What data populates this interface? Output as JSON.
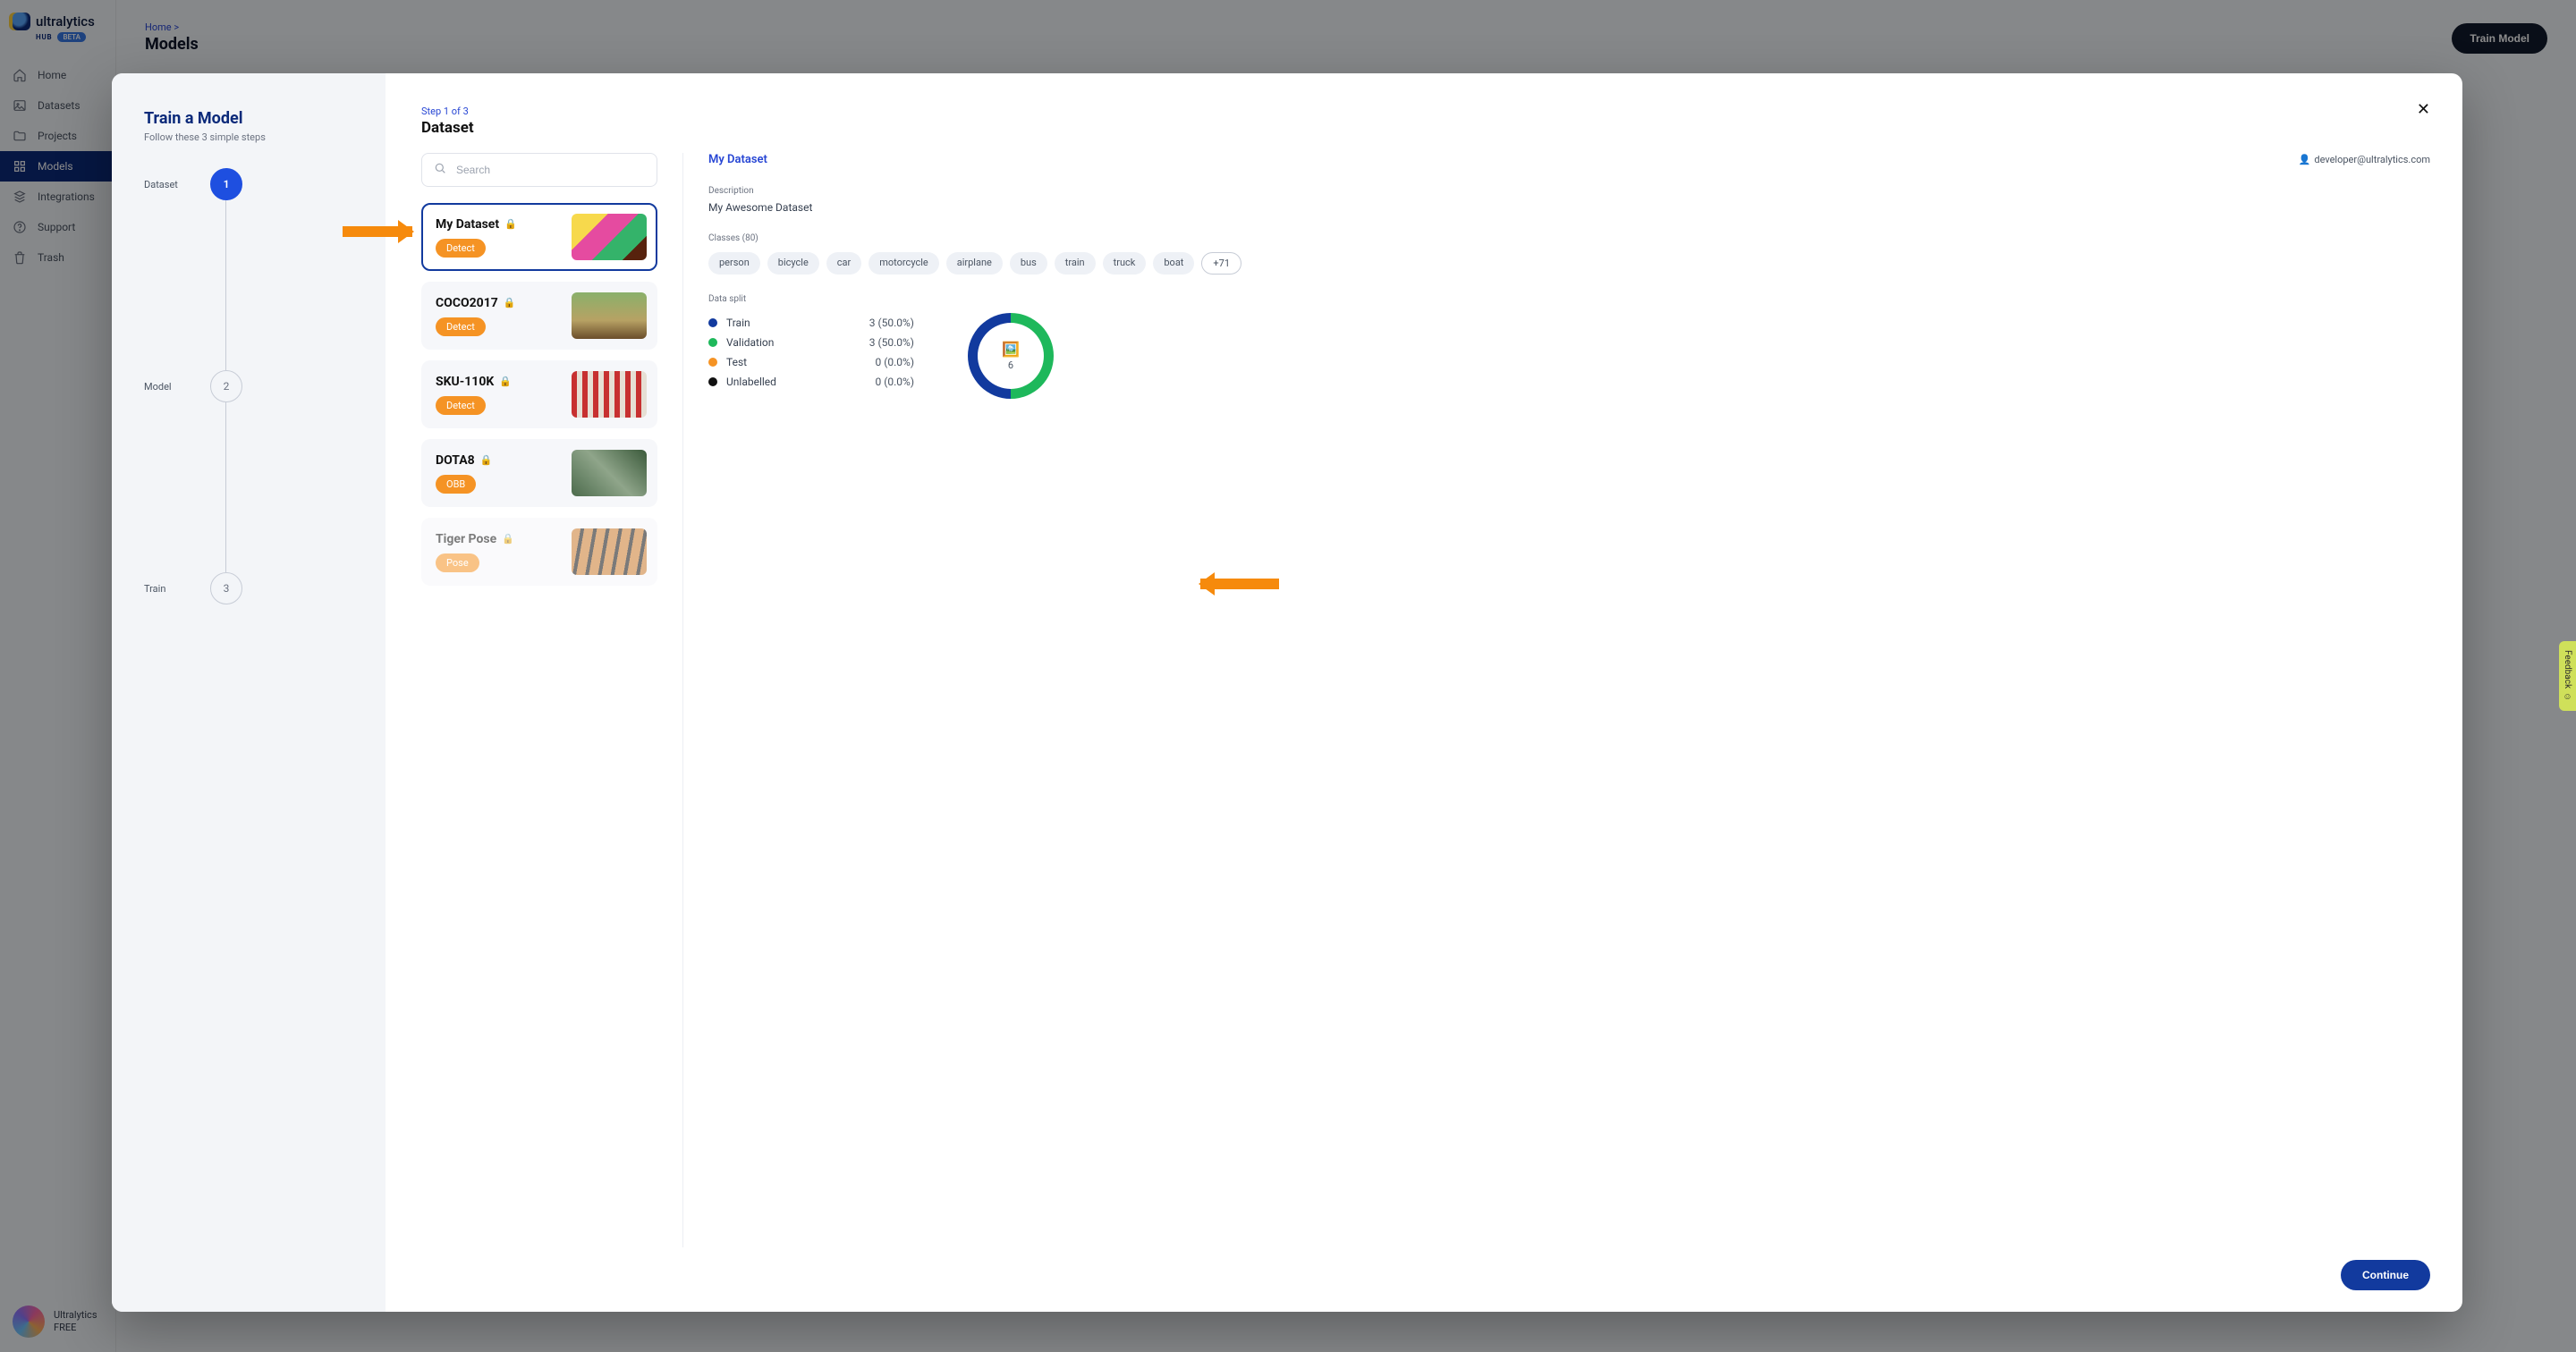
{
  "brand": {
    "name": "ultralytics",
    "hub": "HUB",
    "beta": "BETA"
  },
  "nav": {
    "home": "Home",
    "datasets": "Datasets",
    "projects": "Projects",
    "models": "Models",
    "integrations": "Integrations",
    "support": "Support",
    "trash": "Trash"
  },
  "user": {
    "name": "Ultralytics",
    "plan": "FREE"
  },
  "page": {
    "crumb_home": "Home",
    "crumb_sep": ">",
    "title": "Models",
    "train_btn": "Train Model"
  },
  "modal": {
    "left_title": "Train a Model",
    "left_sub": "Follow these 3 simple steps",
    "steps": {
      "s1": "Dataset",
      "n1": "1",
      "s2": "Model",
      "n2": "2",
      "s3": "Train",
      "n3": "3"
    },
    "step_crumb": "Step 1 of 3",
    "step_title": "Dataset",
    "search_placeholder": "Search",
    "continue": "Continue",
    "datasets": [
      {
        "name": "My Dataset",
        "task": "Detect"
      },
      {
        "name": "COCO2017",
        "task": "Detect"
      },
      {
        "name": "SKU-110K",
        "task": "Detect"
      },
      {
        "name": "DOTA8",
        "task": "OBB"
      },
      {
        "name": "Tiger Pose",
        "task": "Pose"
      }
    ],
    "detail": {
      "title": "My Dataset",
      "email": "developer@ultralytics.com",
      "desc_label": "Description",
      "description": "My Awesome Dataset",
      "classes_label": "Classes (80)",
      "classes": [
        "person",
        "bicycle",
        "car",
        "motorcycle",
        "airplane",
        "bus",
        "train",
        "truck",
        "boat"
      ],
      "classes_more": "+71",
      "split_label": "Data split",
      "split": {
        "train": {
          "name": "Train",
          "value": "3 (50.0%)",
          "color": "#123a9e"
        },
        "val": {
          "name": "Validation",
          "value": "3 (50.0%)",
          "color": "#1eb85b"
        },
        "test": {
          "name": "Test",
          "value": "0 (0.0%)",
          "color": "#f59324"
        },
        "unlab": {
          "name": "Unlabelled",
          "value": "0 (0.0%)",
          "color": "#111111"
        }
      },
      "ring_count": "6"
    }
  },
  "feedback": "Feedback"
}
